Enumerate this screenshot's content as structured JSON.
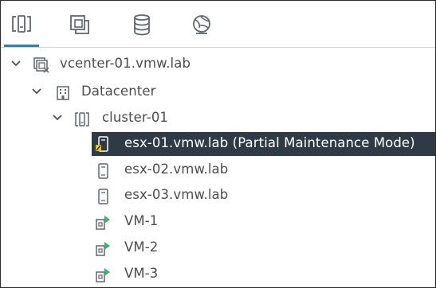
{
  "tabs": [
    {
      "name": "hosts-and-clusters",
      "icon": "hosts-clusters-icon",
      "active": true
    },
    {
      "name": "vms-and-templates",
      "icon": "vms-templates-icon",
      "active": false
    },
    {
      "name": "storage",
      "icon": "database-icon",
      "active": false
    },
    {
      "name": "networking",
      "icon": "globe-network-icon",
      "active": false
    }
  ],
  "tree": {
    "vcenter": {
      "label": "vcenter-01.vmw.lab",
      "icon": "vcenter-icon",
      "expanded": true
    },
    "datacenter": {
      "label": "Datacenter",
      "icon": "datacenter-building-icon",
      "expanded": true
    },
    "cluster": {
      "label": "cluster-01",
      "icon": "cluster-icon",
      "expanded": true
    },
    "hosts": [
      {
        "label": "esx-01.vmw.lab (Partial Maintenance Mode)",
        "icon": "host-maintenance-icon",
        "selected": true
      },
      {
        "label": "esx-02.vmw.lab",
        "icon": "host-icon",
        "selected": false
      },
      {
        "label": "esx-03.vmw.lab",
        "icon": "host-icon",
        "selected": false
      }
    ],
    "vms": [
      {
        "label": "VM-1",
        "icon": "vm-powered-on-icon"
      },
      {
        "label": "VM-2",
        "icon": "vm-powered-on-icon"
      },
      {
        "label": "VM-3",
        "icon": "vm-powered-on-icon"
      }
    ]
  },
  "colors": {
    "selection_bg": "#2e3a46",
    "active_tab_underline": "#2f7fb8",
    "power_on_green": "#3cb371",
    "maintenance_yellow": "#f2c200",
    "text": "#4d4d4d",
    "icon_gray": "#5f6670"
  }
}
